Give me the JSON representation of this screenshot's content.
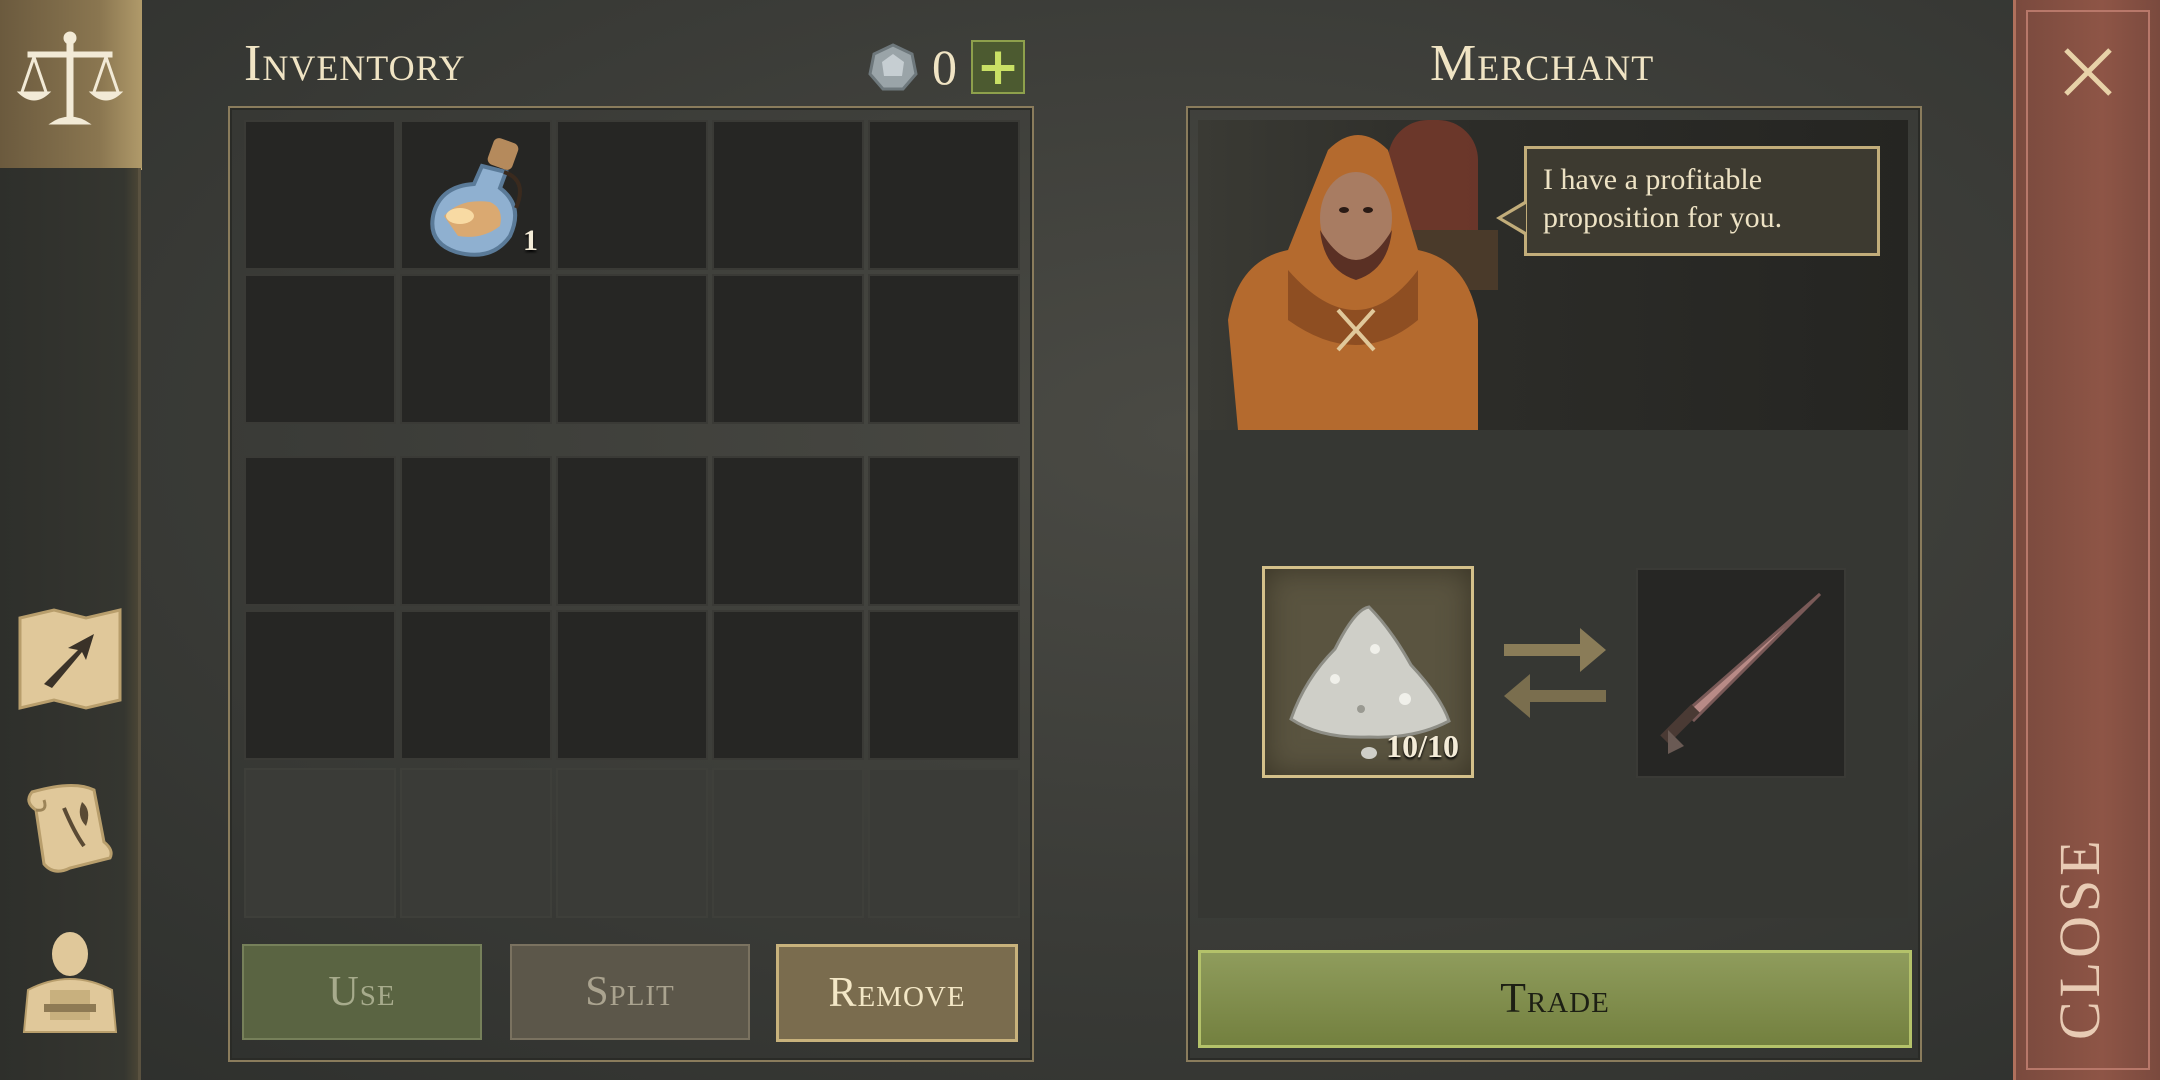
{
  "sidebar": {
    "items": [
      {
        "icon": "scales-icon",
        "active": true
      },
      {
        "icon": "map-icon",
        "active": false
      },
      {
        "icon": "quest-scroll-icon",
        "active": false
      },
      {
        "icon": "character-icon",
        "active": false
      }
    ]
  },
  "inventory": {
    "title": "Inventory",
    "currency": {
      "icon": "coin-icon",
      "amount": "0",
      "add_label": "+"
    },
    "slots": [
      {
        "item": null
      },
      {
        "item": "potion-icon",
        "count": "1"
      },
      {
        "item": null
      },
      {
        "item": null
      },
      {
        "item": null
      },
      {
        "item": null
      },
      {
        "item": null
      },
      {
        "item": null
      },
      {
        "item": null
      },
      {
        "item": null
      }
    ],
    "buttons": {
      "use": "Use",
      "split": "Split",
      "remove": "Remove"
    }
  },
  "merchant": {
    "title": "Merchant",
    "speech": "I have a profitable proposition for you.",
    "offer": {
      "give_item": "salt-pile-icon",
      "give_count": "10/10",
      "get_item": "sword-icon"
    },
    "trade_label": "Trade"
  },
  "close_label": "CLOSE",
  "colors": {
    "accent_gold": "#c8b27c",
    "trade_green": "#8f9c5c",
    "close_red": "#8e5546"
  }
}
